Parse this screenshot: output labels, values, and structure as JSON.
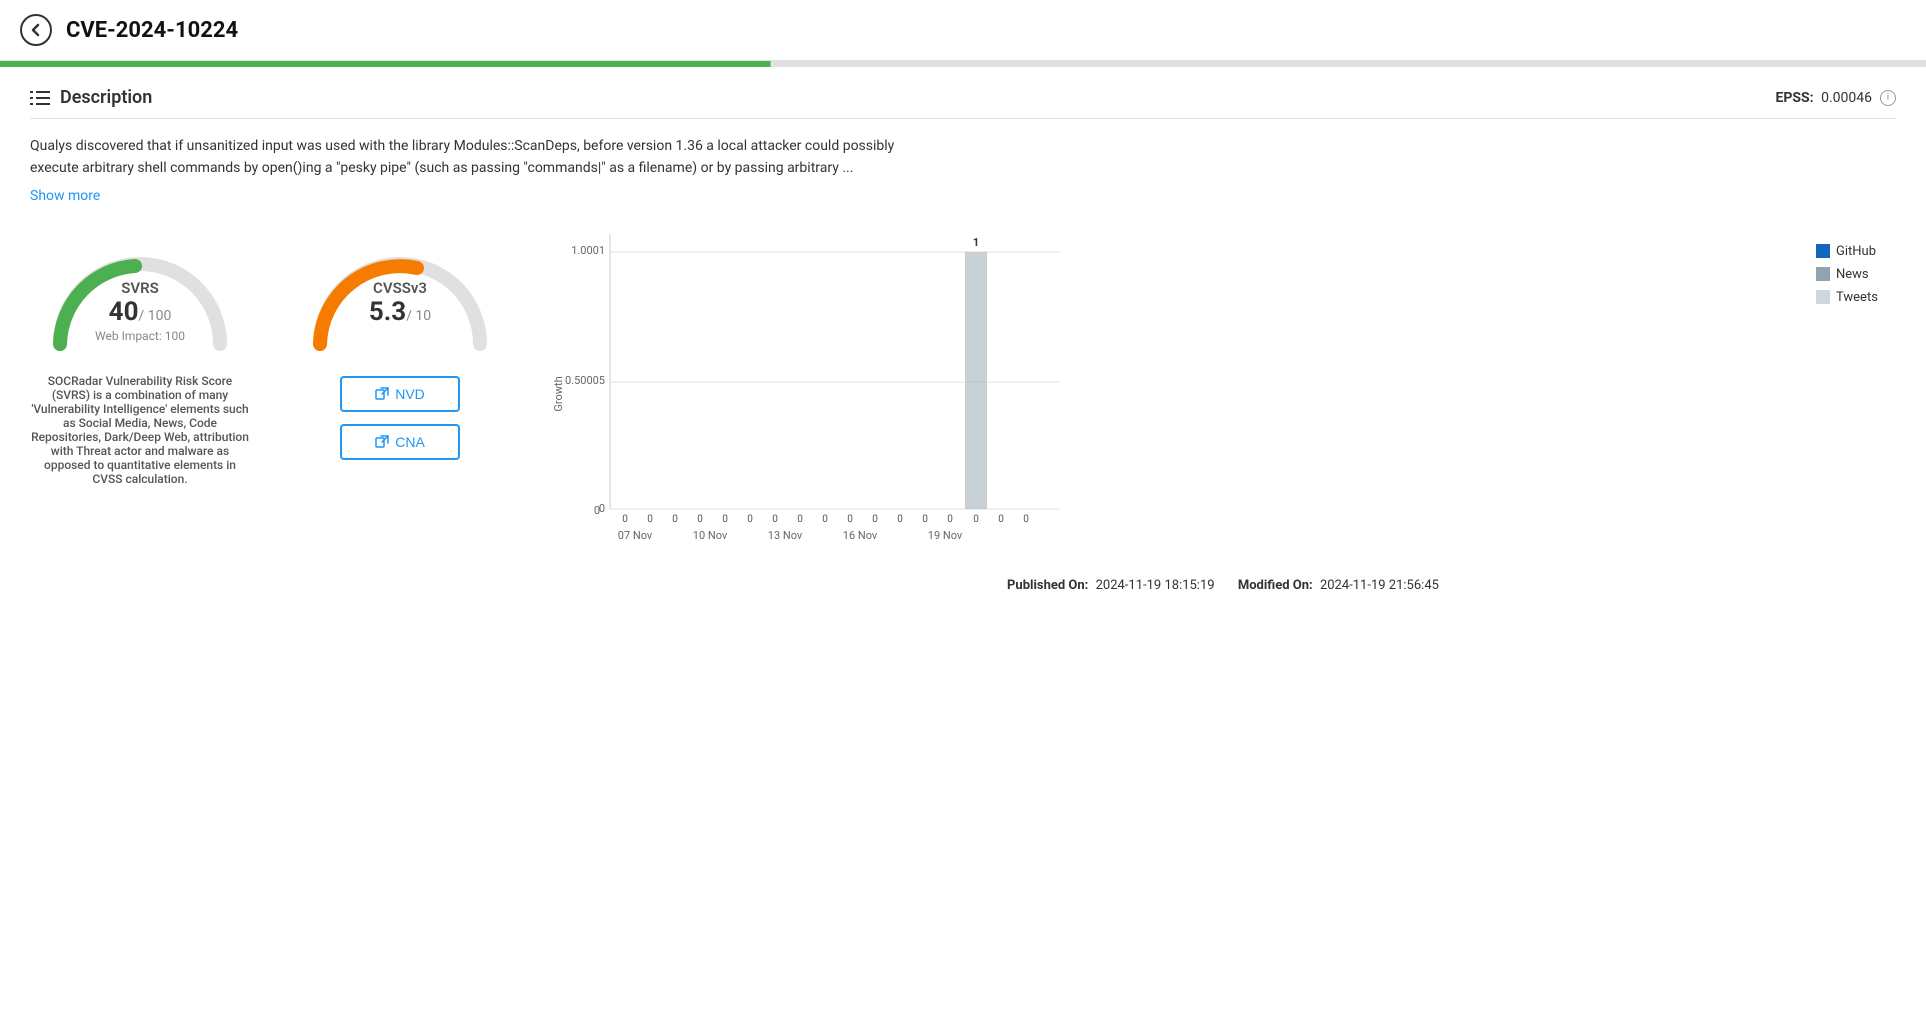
{
  "header": {
    "cve_id": "CVE-2024-10224",
    "back_icon": "←"
  },
  "description": {
    "section_title": "Description",
    "epss_label": "EPSS:",
    "epss_value": "0.00046",
    "text": "Qualys discovered that if unsanitized input was used with the library Modules::ScanDeps, before version 1.36 a local attacker could possibly execute arbitrary shell commands by open()ing a \"pesky pipe\" (such as passing \"commands|\" as a filename) or by passing arbitrary ...",
    "show_more": "Show more"
  },
  "svrs": {
    "label": "SVRS",
    "value": "40",
    "denom": "/ 100",
    "sub": "Web Impact: 100",
    "info_text": "SOCRadar Vulnerability Risk Score (SVRS) is a combination of many 'Vulnerability Intelligence' elements such as Social Media, News, Code Repositories, Dark/Deep Web, attribution with Threat actor and malware as opposed to quantitative elements in CVSS calculation.",
    "color": "#4caf50",
    "score_pct": 40
  },
  "cvss": {
    "label": "CVSSv3",
    "value": "5.3",
    "denom": "/ 10",
    "color": "#f57c00",
    "score_pct": 53,
    "nvd_label": "NVD",
    "cna_label": "CNA"
  },
  "chart": {
    "y_labels": [
      "1.0001",
      "0.50005",
      "0"
    ],
    "x_labels": [
      "07 Nov",
      "10 Nov",
      "13 Nov",
      "16 Nov",
      "19 Nov"
    ],
    "y_axis_title": "Growth",
    "bar_label": "1",
    "bars": [
      0,
      0,
      0,
      0,
      0,
      0,
      0,
      0,
      0,
      0,
      0,
      0,
      0,
      0,
      1,
      0,
      0
    ],
    "bar_dates_labels": [
      "0",
      "0",
      "0",
      "0",
      "0",
      "0",
      "0",
      "0",
      "0",
      "0",
      "0",
      "0",
      "0",
      "0",
      "0",
      "0",
      "0"
    ],
    "legend": [
      {
        "label": "GitHub",
        "color": "#1565c0"
      },
      {
        "label": "News",
        "color": "#90a4ae"
      },
      {
        "label": "Tweets",
        "color": "#cfd8dc"
      }
    ]
  },
  "footer": {
    "published_label": "Published On:",
    "published_date": "2024-11-19 18:15:19",
    "modified_label": "Modified On:",
    "modified_date": "2024-11-19 21:56:45"
  }
}
